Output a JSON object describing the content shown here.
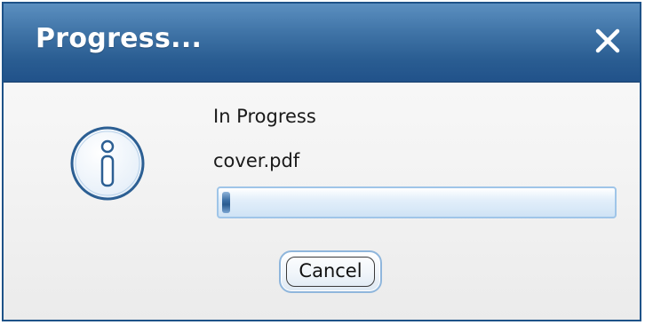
{
  "dialog": {
    "title": "Progress...",
    "close_icon": "close-icon",
    "info_icon": "info-icon",
    "status": "In Progress",
    "file_name": "cover.pdf",
    "progress_fraction": 0.02,
    "cancel_label": "Cancel"
  },
  "colors": {
    "titlebar": "#2f649a",
    "border": "#1e5288",
    "accent": "#3c6fa5",
    "progress_track": "#cfe3f5"
  }
}
